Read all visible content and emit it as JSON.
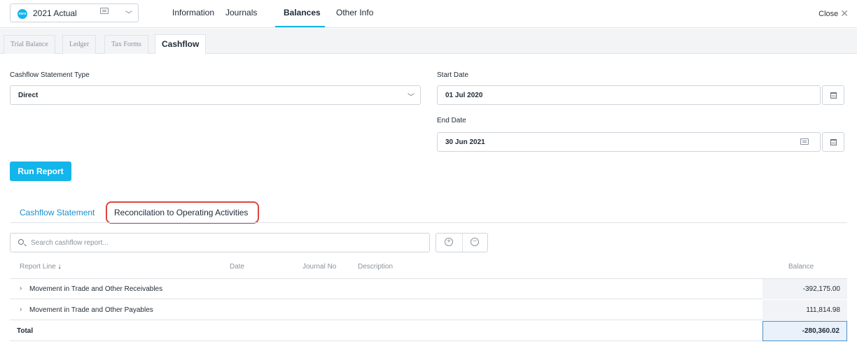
{
  "header": {
    "entity": "2021 Actual",
    "entity_logo_text": "xero",
    "nav": [
      "Information",
      "Journals",
      "Balances",
      "Other Info"
    ],
    "active_nav": "Balances",
    "close_label": "Close"
  },
  "subtabs": [
    "Trial Balance",
    "Ledger",
    "Tax Forms",
    "Cashflow"
  ],
  "active_subtab": "Cashflow",
  "form": {
    "type_label": "Cashflow Statement Type",
    "type_value": "Direct",
    "start_label": "Start Date",
    "start_value": "01 Jul 2020",
    "end_label": "End Date",
    "end_value": "30 Jun 2021",
    "run_label": "Run Report"
  },
  "report_tabs": [
    "Cashflow Statement",
    "Reconcilation to Operating Activities"
  ],
  "search": {
    "placeholder": "Search cashflow report..."
  },
  "table": {
    "headers": [
      "Report Line",
      "Date",
      "Journal No",
      "Description",
      "Balance"
    ],
    "rows": [
      {
        "label": "Movement in Trade and Other Receivables",
        "balance": "-392,175.00"
      },
      {
        "label": "Movement in Trade and Other Payables",
        "balance": "111,814.98"
      }
    ],
    "total": {
      "label": "Total",
      "balance": "-280,360.02"
    }
  },
  "colors": {
    "accent": "#13b5ea",
    "highlight": "#d9473f",
    "link": "#1a8fd0"
  },
  "icons": [
    "xero-logo-icon",
    "card-icon",
    "chevron-down-icon",
    "close-icon",
    "calendar-icon",
    "search-icon",
    "plus-circle-icon",
    "minus-circle-icon",
    "arrow-down-icon",
    "chevron-right-icon"
  ]
}
